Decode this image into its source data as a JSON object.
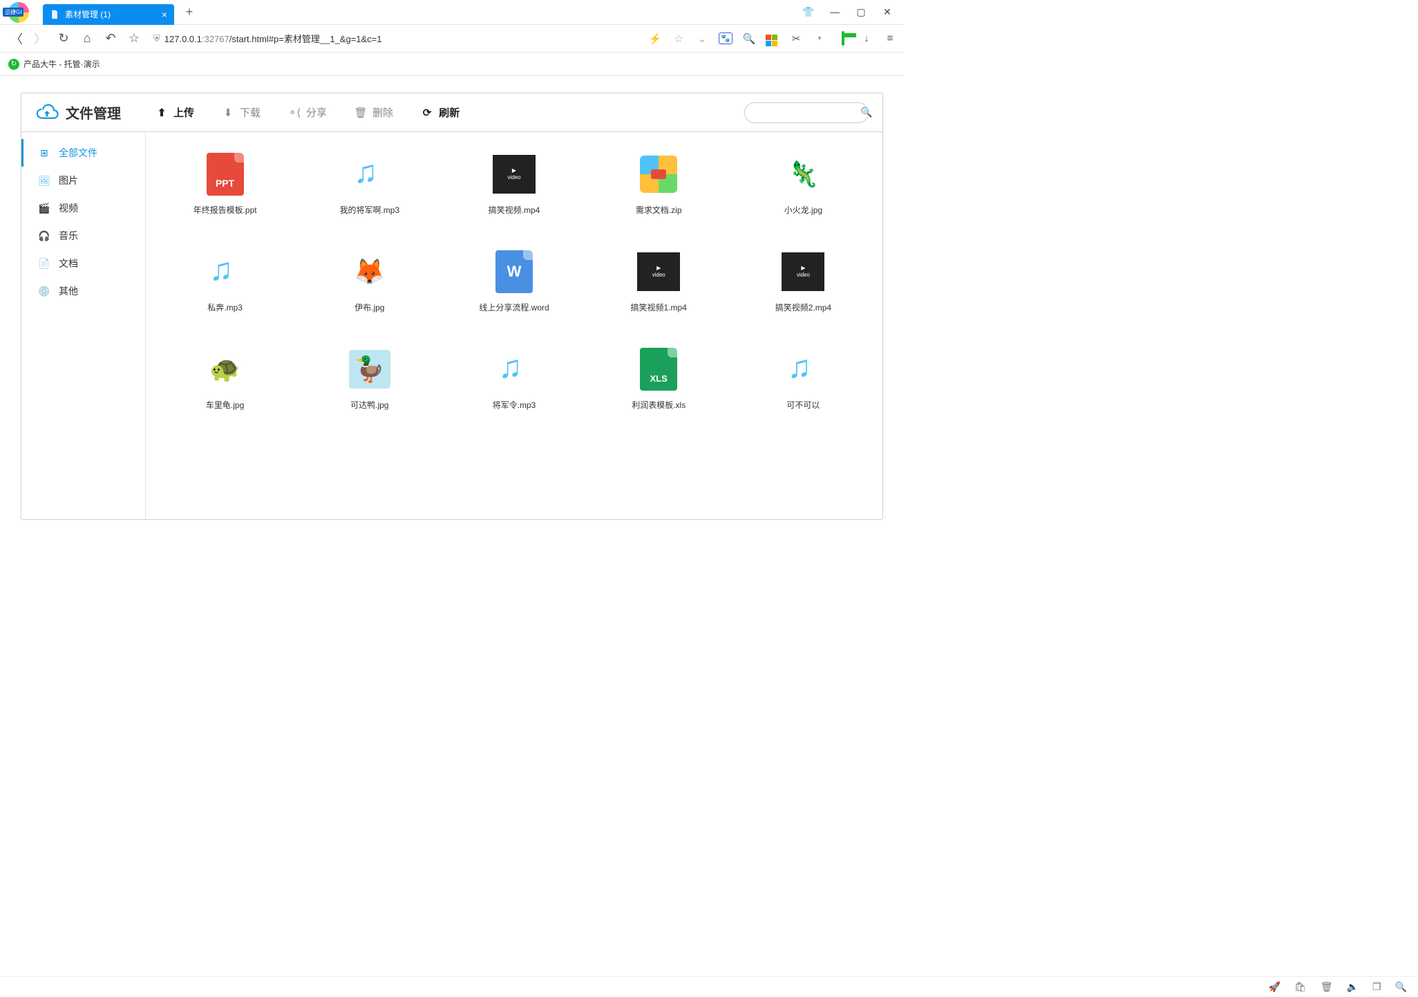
{
  "browser": {
    "tab_title": "素材管理 (1)",
    "url_host": "127.0.0.1",
    "url_port": ":32767",
    "url_path": "/start.html#p=素材管理__1_&g=1&c=1",
    "bookmark": "产品大牛 - 托管·演示"
  },
  "page": {
    "brand_title": "文件管理",
    "toolbar": {
      "upload": "上传",
      "download": "下载",
      "share": "分享",
      "delete": "删除",
      "refresh": "刷新"
    },
    "search_placeholder": "",
    "sidebar": {
      "all": "全部文件",
      "image": "图片",
      "video": "视频",
      "music": "音乐",
      "doc": "文档",
      "other": "其他"
    },
    "files": [
      {
        "name": "年终报告模板.ppt",
        "type": "ppt"
      },
      {
        "name": "我的将军啊.mp3",
        "type": "audio"
      },
      {
        "name": "搞笑视频.mp4",
        "type": "video"
      },
      {
        "name": "需求文档.zip",
        "type": "zip"
      },
      {
        "name": "小火龙.jpg",
        "type": "img",
        "emoji": "🦎",
        "bg": "#fff"
      },
      {
        "name": "私奔.mp3",
        "type": "audio"
      },
      {
        "name": "伊布.jpg",
        "type": "img",
        "emoji": "🦊",
        "bg": "#fff"
      },
      {
        "name": "线上分享流程.word",
        "type": "word"
      },
      {
        "name": "搞笑视频1.mp4",
        "type": "video"
      },
      {
        "name": "搞笑视频2.mp4",
        "type": "video"
      },
      {
        "name": "车里龟.jpg",
        "type": "img",
        "emoji": "🐢",
        "bg": "#fff"
      },
      {
        "name": "可达鸭.jpg",
        "type": "img",
        "emoji": "🦆",
        "bg": "#bde6f2"
      },
      {
        "name": "将军令.mp3",
        "type": "audio"
      },
      {
        "name": "利润表模板.xls",
        "type": "xls"
      },
      {
        "name": "可不可以",
        "type": "audio"
      }
    ]
  }
}
